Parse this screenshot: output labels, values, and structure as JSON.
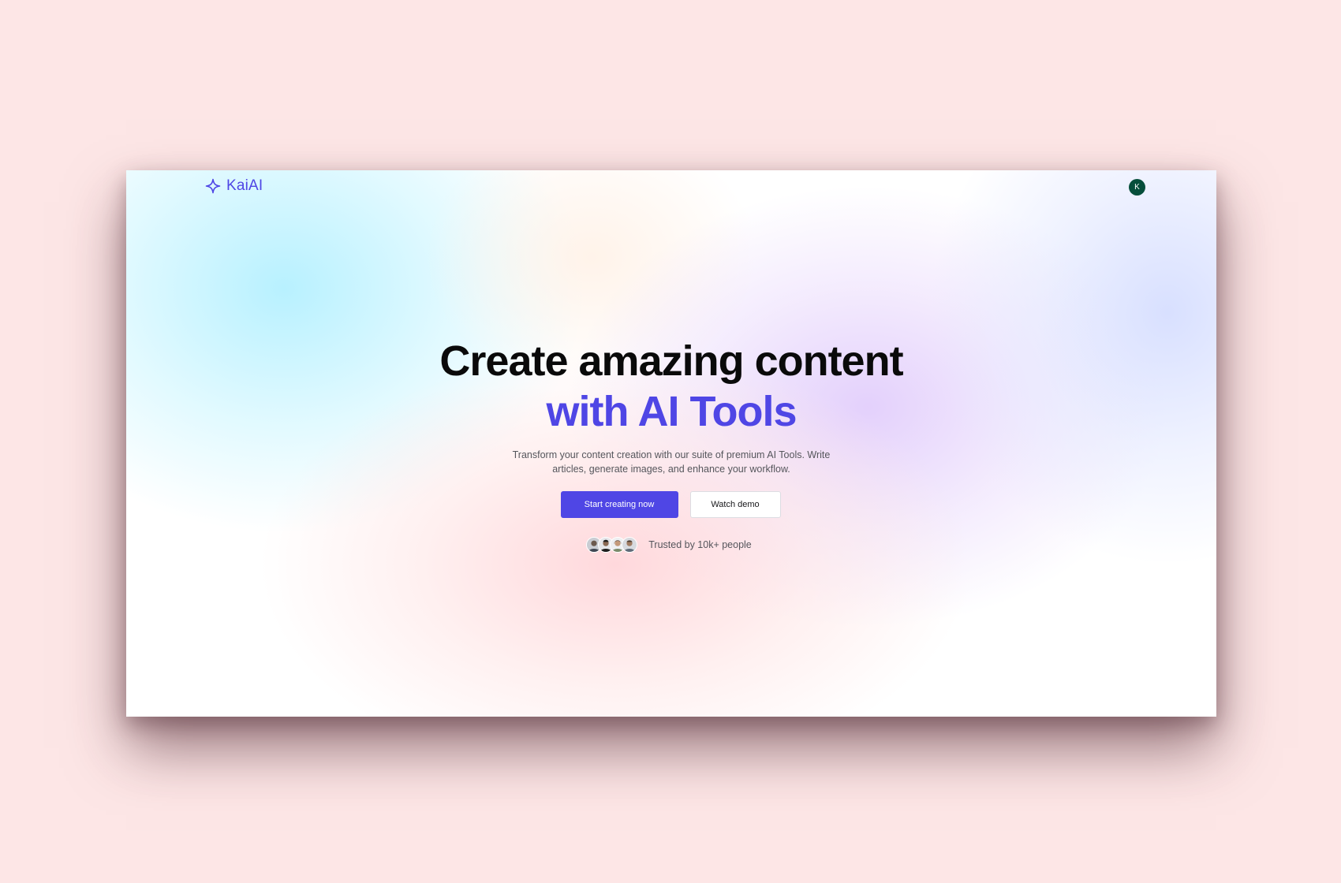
{
  "nav": {
    "brand_name": "KaiAI",
    "brand_icon": "sparkle-icon",
    "user_initial": "K"
  },
  "hero": {
    "headline_line1": "Create amazing content",
    "headline_line2": "with AI Tools",
    "subtitle": "Transform your content creation with our suite of premium AI Tools. Write articles, generate images, and enhance your workflow.",
    "primary_cta": "Start creating now",
    "secondary_cta": "Watch demo",
    "trust_text": "Trusted by 10k+ people"
  },
  "colors": {
    "page_background": "#fde6e6",
    "accent": "#4f46e5",
    "avatar_background": "#064e3b",
    "headline": "#0a0a0a",
    "body_text": "#55565c"
  }
}
